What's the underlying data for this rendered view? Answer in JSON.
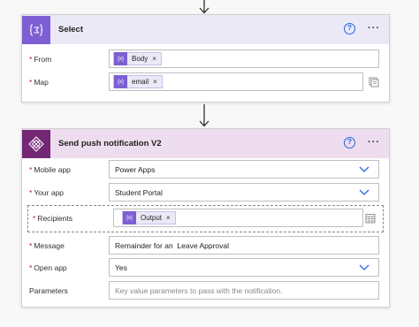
{
  "colors": {
    "select_accent": "#7d5fd3",
    "select_header_bg": "#ece9f7",
    "push_accent": "#742774",
    "push_header_bg": "#eeddee",
    "link_blue": "#2266e3",
    "required_red": "#a4262c"
  },
  "select_card": {
    "icon": "data-operation-icon",
    "title": "Select",
    "help_icon": "help-icon",
    "menu_label": "···",
    "from": {
      "label": "From",
      "token_label": "Body"
    },
    "map": {
      "label": "Map",
      "token_label": "email"
    },
    "token_icon_label": "{x}"
  },
  "push_card": {
    "icon": "power-apps-icon",
    "title": "Send push notification V2",
    "menu_label": "···",
    "fields": {
      "mobile_app": {
        "label": "Mobile app",
        "value": "Power Apps"
      },
      "your_app": {
        "label": "Your app",
        "value": "Student Portal"
      },
      "recipients": {
        "label": "Recipients",
        "token_label": "Output"
      },
      "message": {
        "label": "Message",
        "value": "Remainder for an  Leave Approval"
      },
      "open_app": {
        "label": "Open app",
        "value": "Yes"
      },
      "parameters": {
        "label": "Parameters",
        "placeholder": "Key value parameters to pass with the notification."
      }
    }
  },
  "required_mark": "*",
  "help_label": "?",
  "token_close": "×"
}
